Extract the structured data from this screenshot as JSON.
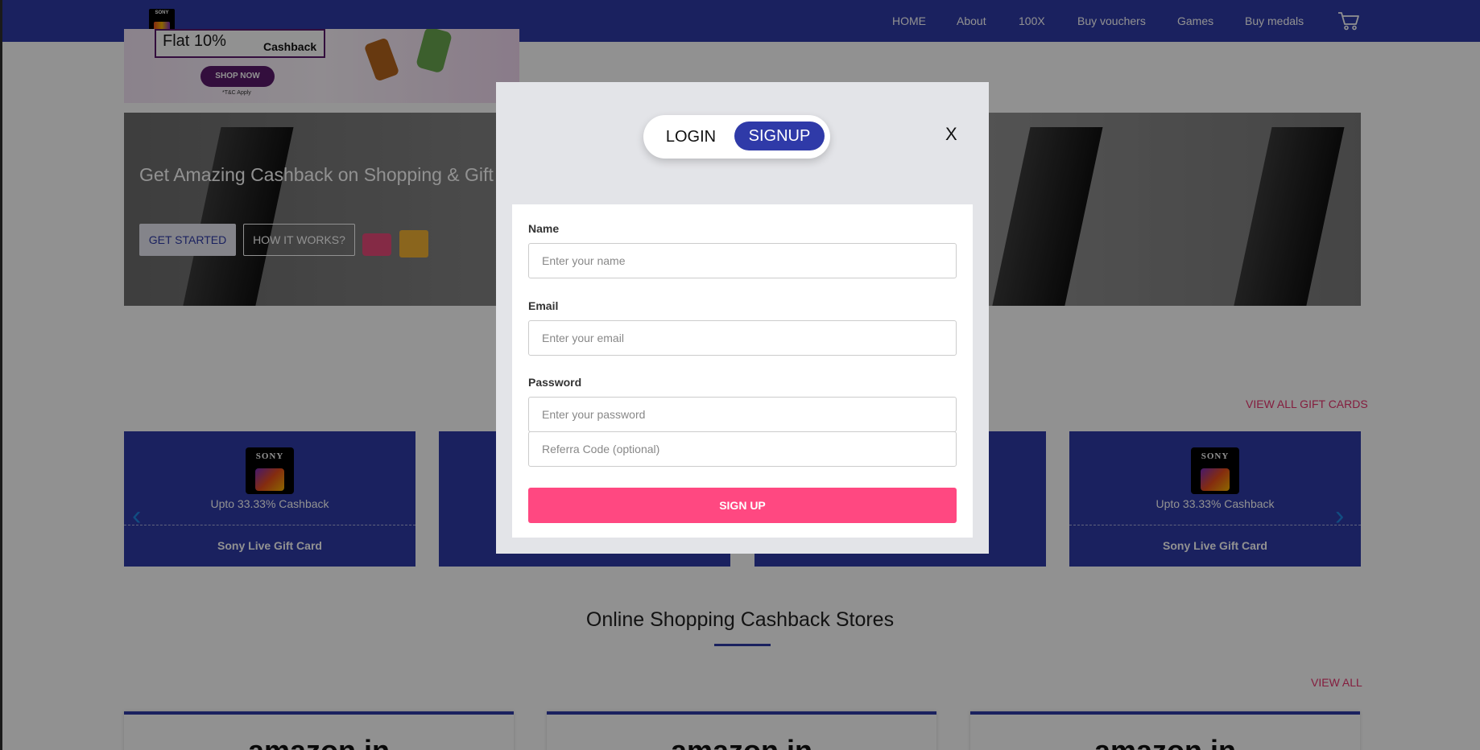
{
  "nav": {
    "items": [
      "HOME",
      "About",
      "100X",
      "Buy vouchers",
      "Games",
      "Buy medals"
    ]
  },
  "logo": {
    "sony": "SONY"
  },
  "promo": {
    "flat": "Flat 10%",
    "cashback": "Cashback",
    "shop_now": "SHOP NOW",
    "tnc": "*T&C Apply"
  },
  "hero": {
    "title": "Get Amazing Cashback on Shopping & Gift Cards",
    "get_started": "GET STARTED",
    "how_it_works": "HOW IT WORKS?"
  },
  "gift_cards": {
    "view_all": "VIEW ALL GIFT CARDS",
    "cards": [
      {
        "logo_text": "SONY",
        "cashback": "Upto 33.33% Cashback",
        "name": "Sony Live Gift Card"
      },
      {
        "logo_text": "SONY",
        "cashback": "Upto 33.33% Cashback",
        "name": "Sony Live Gift Card"
      }
    ]
  },
  "stores": {
    "title": "Online Shopping Cashback Stores",
    "view_all": "VIEW ALL",
    "logos": [
      "amazon.in",
      "amazon.in",
      "amazon.in"
    ]
  },
  "modal": {
    "tab_login": "LOGIN",
    "tab_signup": "SIGNUP",
    "close": "X",
    "name_label": "Name",
    "name_placeholder": "Enter your name",
    "email_label": "Email",
    "email_placeholder": "Enter your email",
    "password_label": "Password",
    "password_placeholder": "Enter your password",
    "referral_placeholder": "Referra Code (optional)",
    "submit": "SIGN UP"
  },
  "colors": {
    "brand_blue": "#2f3aa8",
    "accent_pink": "#ff4881",
    "link_pink": "#e8336e"
  }
}
